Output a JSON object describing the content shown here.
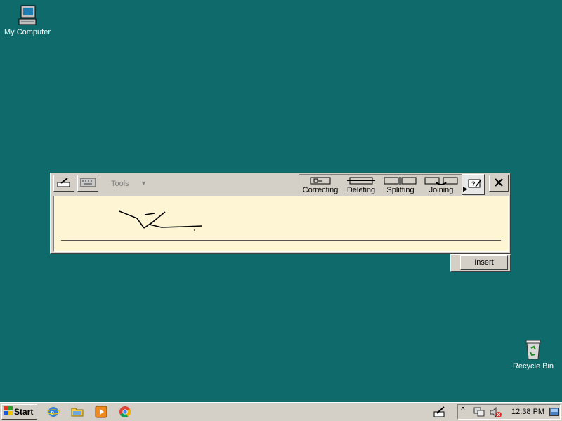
{
  "desktop": {
    "icons": [
      {
        "label": "My Computer",
        "icon": "my-computer-icon"
      },
      {
        "label": "Recycle Bin",
        "icon": "recycle-bin-icon"
      }
    ],
    "background_color": "#0f6b6b"
  },
  "input_panel": {
    "tools_label": "Tools",
    "gestures": [
      {
        "label": "Correcting"
      },
      {
        "label": "Deleting"
      },
      {
        "label": "Splitting"
      },
      {
        "label": "Joining"
      }
    ],
    "insert_label": "Insert",
    "pad_color": "#fdf5d4"
  },
  "taskbar": {
    "start_label": "Start",
    "quick_launch": [
      "internet-explorer-icon",
      "folder-icon",
      "media-player-icon",
      "chrome-icon"
    ],
    "clock": "12:38 PM"
  }
}
